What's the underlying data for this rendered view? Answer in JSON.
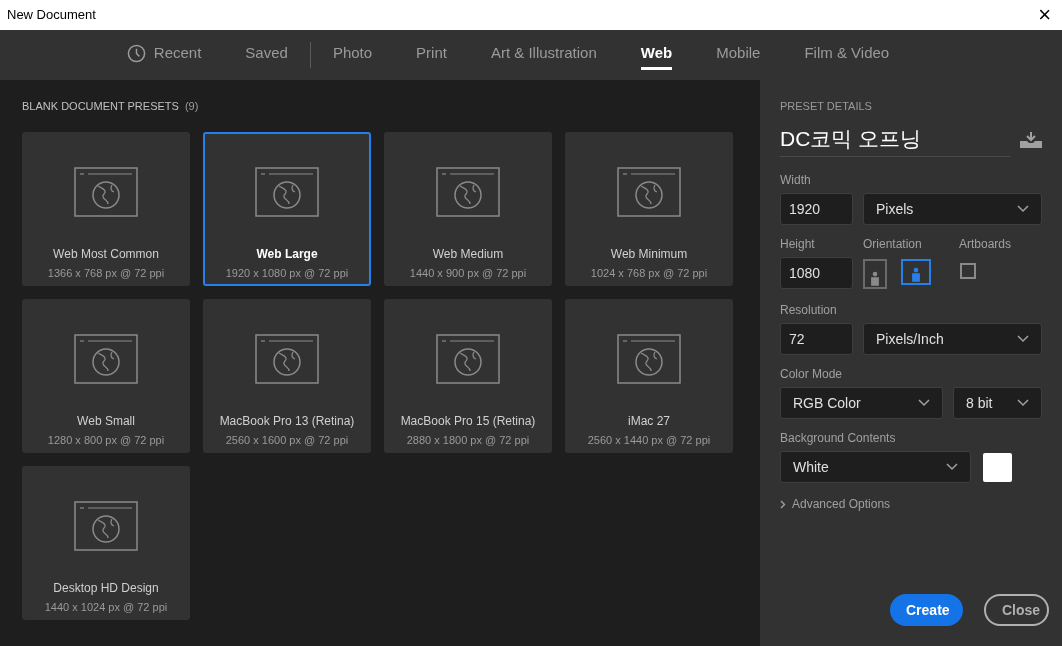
{
  "window": {
    "title": "New Document",
    "close": "×"
  },
  "tabs": [
    {
      "label": "Recent",
      "kind": "clock",
      "selected": false
    },
    {
      "label": "Saved",
      "kind": "plain",
      "selected": false
    },
    {
      "label": "Photo",
      "kind": "plain",
      "selected": false
    },
    {
      "label": "Print",
      "kind": "plain",
      "selected": false
    },
    {
      "label": "Art & Illustration",
      "kind": "plain",
      "selected": false
    },
    {
      "label": "Web",
      "kind": "plain",
      "selected": true
    },
    {
      "label": "Mobile",
      "kind": "plain",
      "selected": false
    },
    {
      "label": "Film & Video",
      "kind": "plain",
      "selected": false
    }
  ],
  "presets": {
    "heading": "BLANK DOCUMENT PRESETS",
    "count": "(9)",
    "items": [
      {
        "name": "Web Most Common",
        "size": "1366 x 768 px @ 72 ppi",
        "selected": false
      },
      {
        "name": "Web Large",
        "size": "1920 x 1080 px @ 72 ppi",
        "selected": true
      },
      {
        "name": "Web Medium",
        "size": "1440 x 900 px @ 72 ppi",
        "selected": false
      },
      {
        "name": "Web Minimum",
        "size": "1024 x 768 px @ 72 ppi",
        "selected": false
      },
      {
        "name": "Web Small",
        "size": "1280 x 800 px @ 72 ppi",
        "selected": false
      },
      {
        "name": "MacBook Pro 13 (Retina)",
        "size": "2560 x 1600 px @ 72 ppi",
        "selected": false
      },
      {
        "name": "MacBook Pro 15 (Retina)",
        "size": "2880 x 1800 px @ 72 ppi",
        "selected": false
      },
      {
        "name": "iMac 27",
        "size": "2560 x 1440 px @ 72 ppi",
        "selected": false
      },
      {
        "name": "Desktop HD Design",
        "size": "1440 x 1024 px @ 72 ppi",
        "selected": false
      }
    ]
  },
  "details": {
    "heading": "PRESET DETAILS",
    "name": "DC코믹 오프닝",
    "width": {
      "label": "Width",
      "value": "1920",
      "unit": "Pixels"
    },
    "height": {
      "label": "Height",
      "value": "1080"
    },
    "orientation": {
      "label": "Orientation",
      "options": [
        {
          "kind": "portrait",
          "selected": false
        },
        {
          "kind": "landscape",
          "selected": true
        }
      ]
    },
    "artboards": {
      "label": "Artboards",
      "checked": false
    },
    "resolution": {
      "label": "Resolution",
      "value": "72",
      "unit": "Pixels/Inch"
    },
    "color_mode": {
      "label": "Color Mode",
      "mode": "RGB Color",
      "depth": "8 bit"
    },
    "background": {
      "label": "Background Contents",
      "value": "White",
      "color": "#ffffff"
    },
    "advanced": {
      "label": "Advanced Options",
      "expanded": false
    }
  },
  "buttons": [
    {
      "label": "Create",
      "kind": "primary"
    },
    {
      "label": "Close",
      "kind": "secondary"
    }
  ]
}
